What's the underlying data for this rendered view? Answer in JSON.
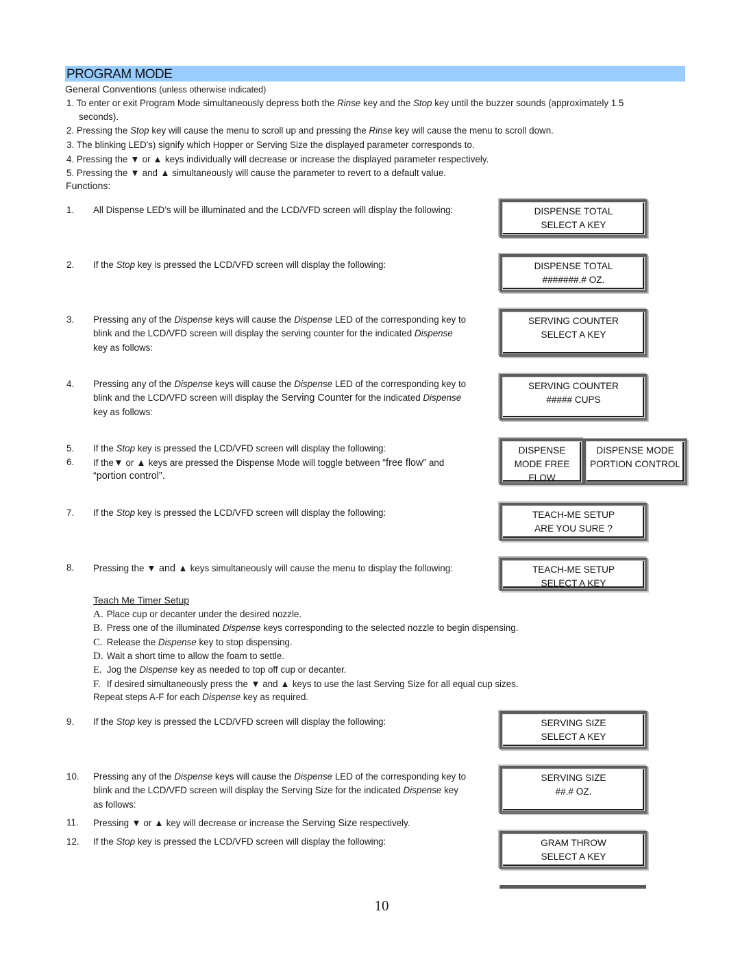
{
  "section": {
    "title": "PROGRAM MODE",
    "banner_color": "#99ccff"
  },
  "general": {
    "heading": "General Conventions",
    "heading_note": "(unless otherwise indicated)",
    "items": [
      {
        "num": "1.",
        "parts": [
          "To enter or exit Program Mode simultaneously depress both the ",
          "Rinse",
          " key and the ",
          "Stop",
          " key until the buzzer sounds (approximately 1.5"
        ],
        "cont": "seconds)."
      },
      {
        "num": "2.",
        "parts": [
          "Pressing the ",
          "Stop",
          " key will cause the menu to scroll up and pressing the ",
          "Rinse",
          " key will cause the menu to scroll down."
        ]
      },
      {
        "num": "3.",
        "text": "The blinking LED's) signify which Hopper or Serving Size the displayed parameter corresponds to."
      },
      {
        "num": "4.",
        "pre": "Pressing the ",
        "down": "▼",
        "mid": " or ",
        "up": "▲",
        "post": "  keys individually will decrease or increase the displayed parameter respectively."
      },
      {
        "num": "5.",
        "pre": "Pressing the ",
        "down": "▼",
        "mid": " and ",
        "up": "▲",
        "post": "  simultaneously will cause the parameter to revert to a default value."
      }
    ]
  },
  "functions": {
    "heading": "Functions:",
    "items": [
      {
        "num": "1.",
        "text": "All Dispense LED’s will be illuminated and the LCD/VFD screen will display the following:"
      },
      {
        "num": "2.",
        "pre": "If the ",
        "em": "Stop",
        "post": " key is pressed the LCD/VFD screen will display the following:"
      },
      {
        "num": "3.",
        "l1": [
          "Pressing any of the ",
          "Dispense",
          " keys will cause the ",
          "Dispense",
          " LED of the corresponding key to"
        ],
        "l2": [
          "blink and the LCD/VFD screen will display the serving counter for the indicated ",
          "Dispense"
        ],
        "l3": "key as follows:"
      },
      {
        "num": "4.",
        "l1": [
          "Pressing any of the ",
          "Dispense",
          " keys will cause the ",
          "Dispense",
          " LED of the corresponding key to"
        ],
        "l2": [
          "blink and the LCD/VFD screen will display the ",
          "Serving Counter",
          " for the indicated ",
          "Dispense"
        ],
        "l3": "key as follows:"
      },
      {
        "num": "5.",
        "pre": "If the ",
        "em": "Stop",
        "post": " key is pressed the LCD/VFD screen will display the following:"
      },
      {
        "num": "6.",
        "pre": "If the",
        "down": "▼",
        "mid": " or ",
        "up": "▲",
        "post": "  keys are pressed the Dispense Mode will toggle between ",
        "q1": "“free flow”",
        "and": " and",
        "q2": "“portion control”."
      },
      {
        "num": "7.",
        "pre": "If the ",
        "em": "Stop",
        "post": " key is pressed the LCD/VFD screen will display the following:"
      },
      {
        "num": "8.",
        "pre": "Pressing the ",
        "down": "▼",
        "mid": " and ",
        "up": "▲",
        "post": "  keys simultaneously will cause the menu to display the following:"
      },
      {
        "num": "9.",
        "pre": "If the ",
        "em": "Stop",
        "post": " key is pressed the LCD/VFD screen will display the following:"
      },
      {
        "num": "10.",
        "l1": [
          "Pressing any of the ",
          "Dispense",
          " keys will cause the ",
          "Dispense",
          " LED of the corresponding key to"
        ],
        "l2": [
          "blink and the LCD/VFD screen will display the Serving Size for the indicated ",
          "Dispense",
          " key"
        ],
        "l3": "as follows:"
      },
      {
        "num": "11.",
        "pre": "Pressing  ",
        "down": "▼",
        "mid": " or ",
        "up": "▲",
        "post": "  key will decrease or increase the ",
        "big": "Serving Size",
        "post2": " respectively."
      },
      {
        "num": "12.",
        "pre": "If the ",
        "em": "Stop",
        "post": " key is pressed the LCD/VFD screen will display the following:"
      }
    ]
  },
  "teach_me": {
    "heading": "Teach Me Timer Setup",
    "steps": [
      {
        "letter": "A.",
        "text": "Place cup or decanter under the desired nozzle."
      },
      {
        "letter": "B.",
        "pre": "Press one of the illuminated ",
        "em": "Dispense",
        "post": " keys corresponding to the selected nozzle to begin dispensing."
      },
      {
        "letter": "C.",
        "pre": "Release the ",
        "em": "Dispense",
        "post": " key to stop dispensing."
      },
      {
        "letter": "D.",
        "text": "Wait a short time to allow the foam to settle."
      },
      {
        "letter": "E.",
        "pre": "Jog the ",
        "em": "Dispense",
        "post": " key as needed to top off cup or decanter."
      },
      {
        "letter": "F.",
        "pre": "If desired simultaneously press the ",
        "down": "▼",
        "mid": " and ",
        "up": "▲",
        "post": "  keys to use the last Serving Size for all equal cup sizes."
      }
    ],
    "repeat": {
      "pre": "Repeat steps A-F for each ",
      "em": "Dispense",
      "post": " key as required."
    }
  },
  "lcd_screens": [
    {
      "lines": [
        "DISPENSE TOTAL",
        "SELECT A KEY"
      ]
    },
    {
      "lines": [
        "DISPENSE TOTAL",
        "#######.# OZ."
      ]
    },
    {
      "lines": [
        "SERVING COUNTER",
        "SELECT A KEY"
      ]
    },
    {
      "lines": [
        "SERVING COUNTER",
        "##### CUPS"
      ]
    },
    {
      "lines": [
        "DISPENSE",
        "MODE FREE",
        "FLOW"
      ]
    },
    {
      "lines": [
        "DISPENSE MODE",
        "PORTION CONTROL"
      ]
    },
    {
      "lines": [
        "TEACH-ME SETUP",
        "ARE YOU SURE ?"
      ]
    },
    {
      "lines": [
        "TEACH-ME SETUP",
        "SELECT A KEY"
      ]
    },
    {
      "lines": [
        "SERVING SIZE",
        "SELECT A KEY"
      ]
    },
    {
      "lines": [
        "SERVING SIZE",
        "##.# OZ."
      ]
    },
    {
      "lines": [
        "GRAM THROW",
        "SELECT A KEY"
      ]
    }
  ],
  "page_number": "10"
}
